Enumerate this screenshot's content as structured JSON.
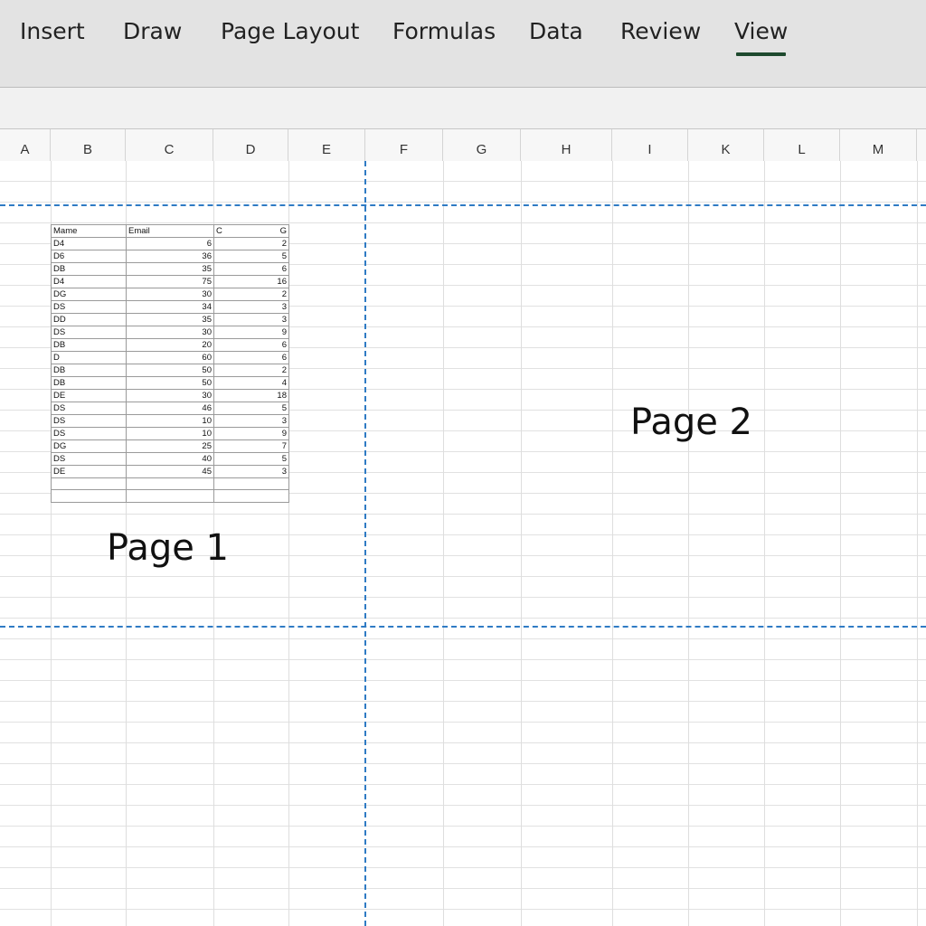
{
  "ribbon": {
    "tabs": [
      {
        "label": "Insert"
      },
      {
        "label": "Draw"
      },
      {
        "label": "Page Layout"
      },
      {
        "label": "Formulas"
      },
      {
        "label": "Data"
      },
      {
        "label": "Review"
      },
      {
        "label": "View",
        "active": true
      }
    ]
  },
  "columns": [
    "A",
    "B",
    "C",
    "D",
    "E",
    "F",
    "G",
    "H",
    "I",
    "K",
    "L",
    "M"
  ],
  "table": {
    "headers": [
      "Mame",
      "Email",
      "C",
      "G"
    ],
    "rows": [
      [
        "D4",
        "6",
        "2"
      ],
      [
        "D6",
        "36",
        "5"
      ],
      [
        "DB",
        "35",
        "6"
      ],
      [
        "D4",
        "75",
        "16"
      ],
      [
        "DG",
        "30",
        "2"
      ],
      [
        "DS",
        "34",
        "3"
      ],
      [
        "DD",
        "35",
        "3"
      ],
      [
        "DS",
        "30",
        "9"
      ],
      [
        "DB",
        "20",
        "6"
      ],
      [
        "D",
        "60",
        "6"
      ],
      [
        "DB",
        "50",
        "2"
      ],
      [
        "DB",
        "50",
        "4"
      ],
      [
        "DE",
        "30",
        "18"
      ],
      [
        "DS",
        "46",
        "5"
      ],
      [
        "DS",
        "10",
        "3"
      ],
      [
        "DS",
        "10",
        "9"
      ],
      [
        "DG",
        "25",
        "7"
      ],
      [
        "DS",
        "40",
        "5"
      ],
      [
        "DE",
        "45",
        "3"
      ],
      [
        "",
        "",
        ""
      ],
      [
        "",
        "",
        ""
      ]
    ]
  },
  "pages": {
    "page1_label": "Page 1",
    "page2_label": "Page 2"
  },
  "colors": {
    "page_break": "#2f7bc4",
    "active_tab_underline": "#1e4a2e",
    "ribbon_bg": "#e3e3e3"
  }
}
